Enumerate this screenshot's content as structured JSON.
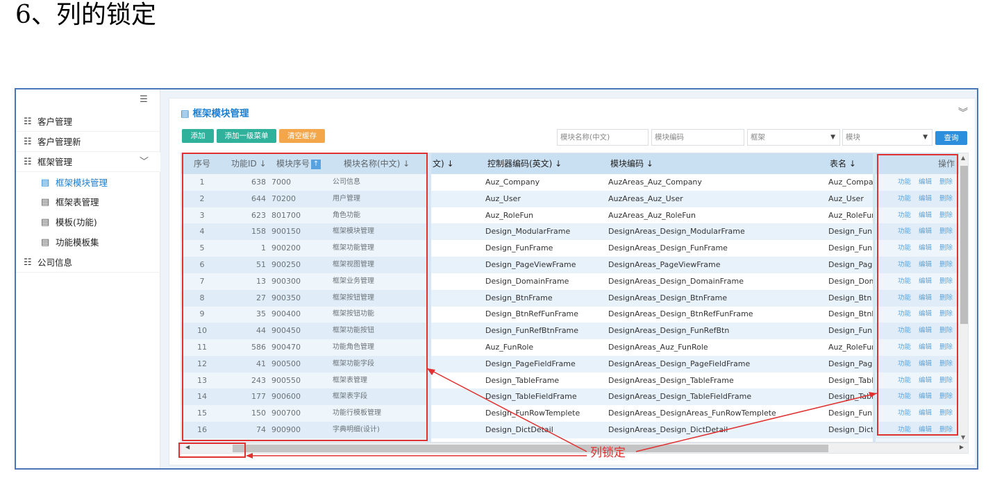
{
  "heading": "6、列的锁定",
  "sidebar": {
    "toggle_icon": "menu-collapse-icon",
    "items": [
      {
        "label": "客户管理"
      },
      {
        "label": "客户管理新"
      },
      {
        "label": "框架管理"
      },
      {
        "label": "公司信息"
      }
    ],
    "subitems": [
      {
        "label": "框架模块管理",
        "active": true
      },
      {
        "label": "框架表管理"
      },
      {
        "label": "模板(功能)"
      },
      {
        "label": "功能模板集"
      }
    ]
  },
  "panel": {
    "title": "框架模块管理",
    "buttons": {
      "add": "添加",
      "add_menu": "添加一级菜单",
      "clear_cache": "清空缓存"
    },
    "filters": {
      "module_name_placeholder": "模块名称(中文)",
      "module_code_placeholder": "模块编码",
      "frame_select": "框架",
      "module_select": "模块"
    },
    "query": "查询"
  },
  "grid": {
    "headers": {
      "seq": "序号",
      "func_id": "功能ID ↓",
      "module_seq": "模块序号",
      "module_seq_sort": "↑",
      "module_name": "模块名称(中文) ↓",
      "partial": "文) ↓",
      "controller": "控制器编码(英文) ↓",
      "module_code": "模块编码 ↓",
      "table_name": "表名 ↓",
      "ops": "操作"
    },
    "ops_labels": {
      "func": "功能",
      "edit": "编辑",
      "del": "删除"
    },
    "rows": [
      {
        "seq": "1",
        "id": "638",
        "mseq": "7000",
        "name": "公司信息",
        "ctrl": "Auz_Company",
        "code": "AuzAreas_Auz_Company",
        "table": "Auz_Company"
      },
      {
        "seq": "2",
        "id": "644",
        "mseq": "70200",
        "name": "用户管理",
        "ctrl": "Auz_User",
        "code": "AuzAreas_Auz_User",
        "table": "Auz_User"
      },
      {
        "seq": "3",
        "id": "623",
        "mseq": "801700",
        "name": "角色功能",
        "ctrl": "Auz_RoleFun",
        "code": "AuzAreas_Auz_RoleFun",
        "table": "Auz_RoleFun"
      },
      {
        "seq": "4",
        "id": "158",
        "mseq": "900150",
        "name": "框架模块管理",
        "ctrl": "Design_ModularFrame",
        "code": "DesignAreas_Design_ModularFrame",
        "table": "Design_Fun"
      },
      {
        "seq": "5",
        "id": "1",
        "mseq": "900200",
        "name": "框架功能管理",
        "ctrl": "Design_FunFrame",
        "code": "DesignAreas_Design_FunFrame",
        "table": "Design_Fun"
      },
      {
        "seq": "6",
        "id": "51",
        "mseq": "900250",
        "name": "框架视图管理",
        "ctrl": "Design_PageViewFrame",
        "code": "DesignAreas_PageViewFrame",
        "table": "Design_PageV"
      },
      {
        "seq": "7",
        "id": "13",
        "mseq": "900300",
        "name": "框架业务管理",
        "ctrl": "Design_DomainFrame",
        "code": "DesignAreas_Design_DomainFrame",
        "table": "Design_Doma"
      },
      {
        "seq": "8",
        "id": "27",
        "mseq": "900350",
        "name": "框架按钮管理",
        "ctrl": "Design_BtnFrame",
        "code": "DesignAreas_Design_BtnFrame",
        "table": "Design_Btn"
      },
      {
        "seq": "9",
        "id": "35",
        "mseq": "900400",
        "name": "框架按钮功能",
        "ctrl": "Design_BtnRefFunFrame",
        "code": "DesignAreas_Design_BtnRefFunFrame",
        "table": "Design_BtnRe"
      },
      {
        "seq": "10",
        "id": "44",
        "mseq": "900450",
        "name": "框架功能按钮",
        "ctrl": "Design_FunRefBtnFrame",
        "code": "DesignAreas_Design_FunRefBtn",
        "table": "Design_FunRe"
      },
      {
        "seq": "11",
        "id": "586",
        "mseq": "900470",
        "name": "功能角色管理",
        "ctrl": "Auz_FunRole",
        "code": "DesignAreas_Auz_FunRole",
        "table": "Auz_RoleFun"
      },
      {
        "seq": "12",
        "id": "41",
        "mseq": "900500",
        "name": "框架功能字段",
        "ctrl": "Design_PageFieldFrame",
        "code": "DesignAreas_Design_PageFieldFrame",
        "table": "Design_Pagef"
      },
      {
        "seq": "13",
        "id": "243",
        "mseq": "900550",
        "name": "框架表管理",
        "ctrl": "Design_TableFrame",
        "code": "DesignAreas_Design_TableFrame",
        "table": "Design_Table"
      },
      {
        "seq": "14",
        "id": "177",
        "mseq": "900600",
        "name": "框架表字段",
        "ctrl": "Design_TableFieldFrame",
        "code": "DesignAreas_Design_TableFieldFrame",
        "table": "Design_Table"
      },
      {
        "seq": "15",
        "id": "150",
        "mseq": "900700",
        "name": "功能行模板管理",
        "ctrl": "Design_FunRowTemplete",
        "code": "DesignAreas_DesignAreas_FunRowTemplete",
        "table": "Design_Fun"
      },
      {
        "seq": "16",
        "id": "74",
        "mseq": "900900",
        "name": "字典明细(设计)",
        "ctrl": "Design_DictDetail",
        "code": "DesignAreas_Design_DictDetail",
        "table": "Design_DictD"
      }
    ]
  },
  "annotation": {
    "label": "列锁定",
    "color": "#e03030"
  }
}
